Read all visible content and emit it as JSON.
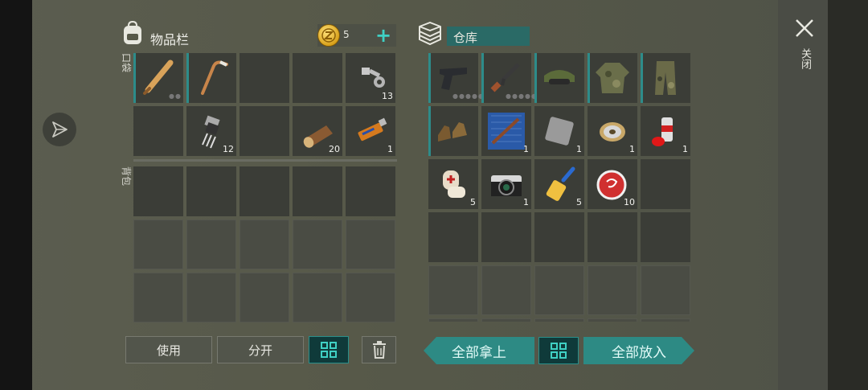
{
  "header": {
    "inventory_title": "物品栏",
    "coin_count": "5",
    "storage_title": "仓库"
  },
  "labels": {
    "pocket": "口袋",
    "backpack": "背包",
    "close": "关闭"
  },
  "pocket_slots": [
    {
      "item": "baseball-bat",
      "qty": "",
      "durability": true
    },
    {
      "item": "hockey-stick",
      "qty": "",
      "durability": true
    },
    {
      "item": "",
      "qty": ""
    },
    {
      "item": "",
      "qty": ""
    },
    {
      "item": "bolt-and-nut",
      "qty": "13"
    },
    {
      "item": "",
      "qty": ""
    },
    {
      "item": "electronic-component",
      "qty": "12"
    },
    {
      "item": "",
      "qty": ""
    },
    {
      "item": "log",
      "qty": "20"
    },
    {
      "item": "usb-flash-drive",
      "qty": "1"
    }
  ],
  "storage_slots": [
    {
      "item": "pistol",
      "qty": "",
      "durability": true
    },
    {
      "item": "assault-rifle",
      "qty": "",
      "durability": true
    },
    {
      "item": "military-cap",
      "qty": "",
      "durability": true
    },
    {
      "item": "camo-jacket",
      "qty": "",
      "durability": true
    },
    {
      "item": "camo-pants",
      "qty": "",
      "durability": true
    },
    {
      "item": "boots",
      "qty": "",
      "durability": true
    },
    {
      "item": "rifle-blueprint",
      "qty": "1"
    },
    {
      "item": "metal-plate",
      "qty": "1"
    },
    {
      "item": "wire-spool",
      "qty": "1"
    },
    {
      "item": "spray-can",
      "qty": "1"
    },
    {
      "item": "bandage",
      "qty": "5"
    },
    {
      "item": "camera",
      "qty": "1"
    },
    {
      "item": "glue",
      "qty": "5"
    },
    {
      "item": "bottle-cap",
      "qty": "10"
    }
  ],
  "buttons": {
    "use": "使用",
    "split": "分开",
    "take_all": "全部拿上",
    "put_all": "全部放入"
  },
  "colors": {
    "accent": "#2d8a84",
    "slot": "#3b3d37",
    "background": "#575949"
  }
}
